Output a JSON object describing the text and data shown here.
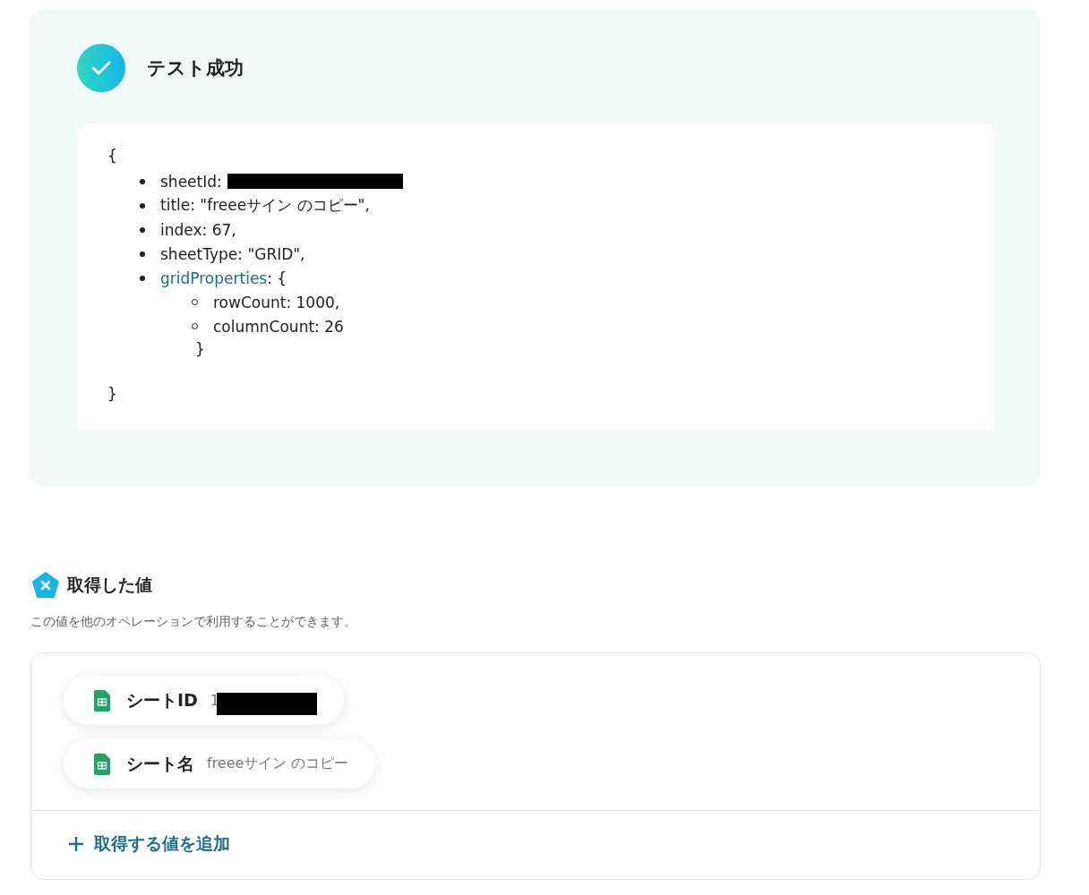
{
  "test_result": {
    "status": "テスト成功",
    "output": {
      "open": "{",
      "close": "}",
      "items": [
        {
          "text": "sheetId:",
          "redacted": true
        },
        {
          "text": "title: \"freeeサイン のコピー\","
        },
        {
          "text": "index: 67,"
        },
        {
          "text": "sheetType: \"GRID\","
        },
        {
          "key": "gridProperties",
          "text": ": {",
          "close": "}",
          "children": [
            {
              "text": "rowCount: 1000,"
            },
            {
              "text": "columnCount: 26"
            }
          ]
        }
      ]
    }
  },
  "values_section": {
    "title": "取得した値",
    "description": "この値を他のオペレーションで利用することができます。",
    "values": [
      {
        "label": "シートID",
        "value": "1",
        "redacted": true
      },
      {
        "label": "シート名",
        "value": "freeeサイン のコピー"
      }
    ],
    "add_button": "取得する値を追加"
  }
}
